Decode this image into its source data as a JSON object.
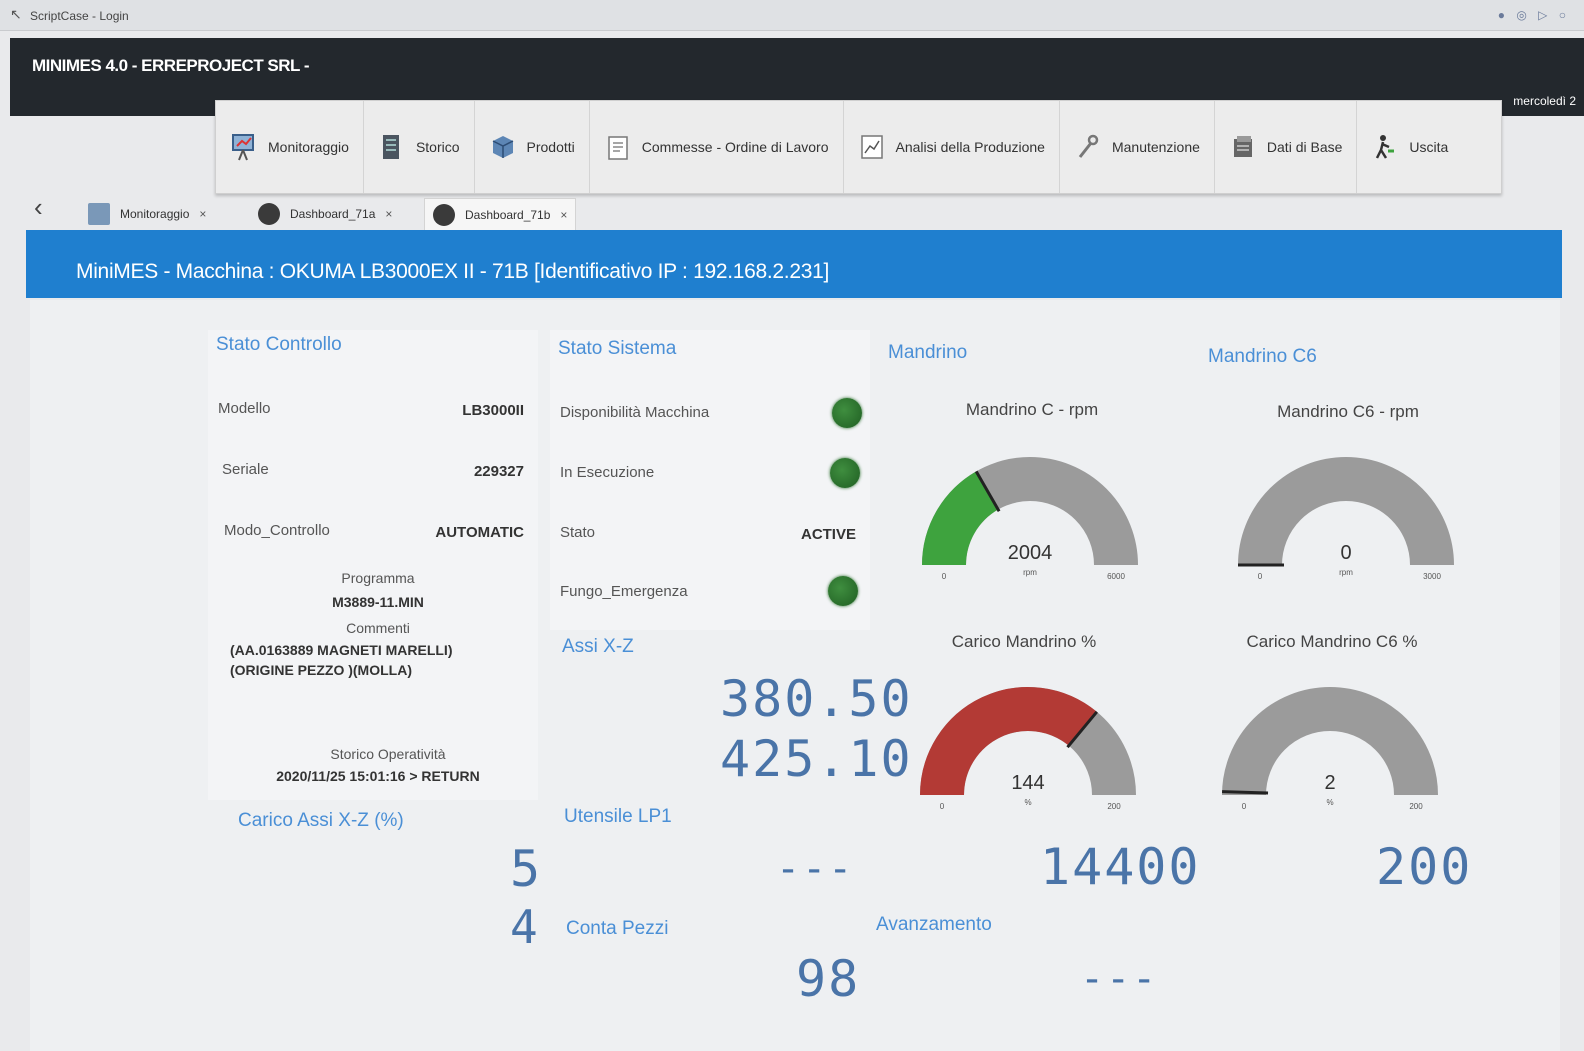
{
  "browser": {
    "title": "ScriptCase - Login"
  },
  "header": {
    "title": "MINIMES 4.0 - ERREPROJECT SRL -",
    "date": "mercoledì 2"
  },
  "menu": [
    {
      "label": "Monitoraggio",
      "icon": "monitor-icon"
    },
    {
      "label": "Storico",
      "icon": "server-icon"
    },
    {
      "label": "Prodotti",
      "icon": "box-icon"
    },
    {
      "label": "Commesse - Ordine di Lavoro",
      "icon": "clipboard-icon"
    },
    {
      "label": "Analisi della Produzione",
      "icon": "chart-icon"
    },
    {
      "label": "Manutenzione",
      "icon": "wrench-icon"
    },
    {
      "label": "Dati di Base",
      "icon": "database-icon"
    },
    {
      "label": "Uscita",
      "icon": "exit-icon"
    }
  ],
  "tabs": [
    {
      "label": "Monitoraggio",
      "close": "×"
    },
    {
      "label": "Dashboard_71a",
      "close": "×"
    },
    {
      "label": "Dashboard_71b",
      "close": "×"
    }
  ],
  "page": {
    "title": "MiniMES - Macchina : OKUMA LB3000EX II - 71B [Identificativo IP : 192.168.2.231]"
  },
  "stato_controllo": {
    "title": "Stato Controllo",
    "modello_label": "Modello",
    "modello_value": "LB3000II",
    "seriale_label": "Seriale",
    "seriale_value": "229327",
    "modo_label": "Modo_Controllo",
    "modo_value": "AUTOMATIC",
    "programma_label": "Programma",
    "programma_value": "M3889-11.MIN",
    "commenti_label": "Commenti",
    "commenti_line1": "(AA.0163889 MAGNETI MARELLI)",
    "commenti_line2": "(ORIGINE PEZZO )(MOLLA)",
    "storico_label": "Storico Operatività",
    "storico_value": "2020/11/25 15:01:16 > RETURN"
  },
  "stato_sistema": {
    "title": "Stato Sistema",
    "disponibilita_label": "Disponibilità Macchina",
    "esecuzione_label": "In Esecuzione",
    "stato_label": "Stato",
    "stato_value": "ACTIVE",
    "fungo_label": "Fungo_Emergenza",
    "led_color": "#2f7a33"
  },
  "assi": {
    "title": "Assi X-Z",
    "x": "380.50",
    "z": "425.10"
  },
  "carico_assi": {
    "title": "Carico Assi X-Z (%)",
    "x": "5",
    "z": "4"
  },
  "utensile": {
    "title": "Utensile LP1",
    "value": "---"
  },
  "conta_pezzi": {
    "title": "Conta Pezzi",
    "value": "98"
  },
  "avanzamento": {
    "title": "Avanzamento",
    "value": "---"
  },
  "mandrino": {
    "title": "Mandrino",
    "rpm_title": "Mandrino C - rpm",
    "rpm_value": "2004",
    "rpm_min": "0",
    "rpm_max": "6000",
    "rpm_unit": "rpm",
    "rpm_fraction": 0.334,
    "rpm_color": "#3ea33e",
    "load_title": "Carico Mandrino %",
    "load_value": "144",
    "load_min": "0",
    "load_max": "200",
    "load_unit": "%",
    "load_fraction": 0.72,
    "load_color": "#b33a35",
    "speed_display": "14400"
  },
  "mandrino_c6": {
    "title": "Mandrino C6",
    "rpm_title": "Mandrino C6 - rpm",
    "rpm_value": "0",
    "rpm_min": "0",
    "rpm_max": "3000",
    "rpm_unit": "rpm",
    "rpm_fraction": 0.0,
    "load_title": "Carico Mandrino C6 %",
    "load_value": "2",
    "load_min": "0",
    "load_max": "200",
    "load_unit": "%",
    "load_fraction": 0.01,
    "speed_display": "200"
  },
  "gauge_track_color": "#9b9b9b",
  "accent_color": "#1f7fcf"
}
